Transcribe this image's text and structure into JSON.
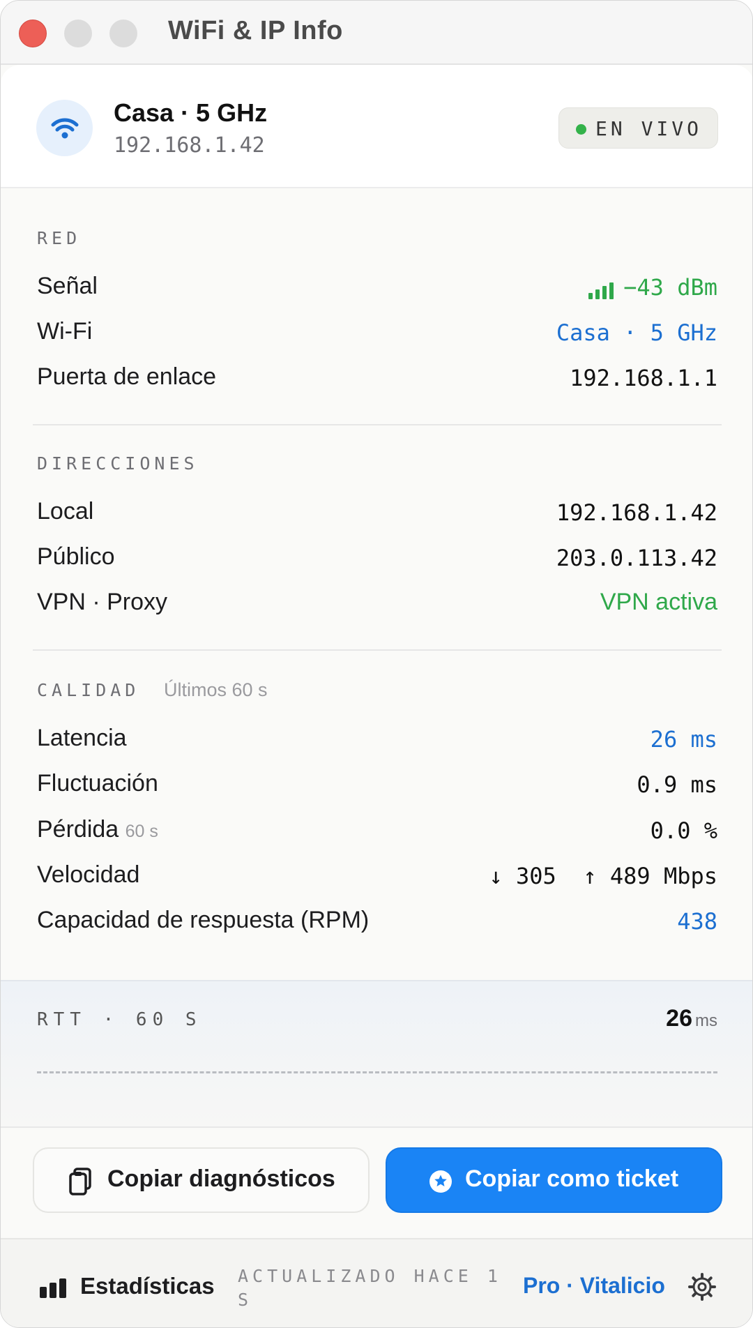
{
  "window": {
    "title": "WiFi & IP Info"
  },
  "header": {
    "network_name": "Casa · 5 GHz",
    "ip": "192.168.1.42",
    "live_label": "EN VIVO",
    "live_color": "#33b24a"
  },
  "red": {
    "label": "RED",
    "signal_label": "Señal",
    "signal_value": "−43 dBm",
    "signal_bars": 4,
    "wifi_label": "Wi-Fi",
    "wifi_value": "Casa · 5 GHz",
    "gateway_label": "Puerta de enlace",
    "gateway_value": "192.168.1.1"
  },
  "direcciones": {
    "label": "DIRECCIONES",
    "local_label": "Local",
    "local_value": "192.168.1.42",
    "public_label": "Público",
    "public_value": "203.0.113.42",
    "vpn_label": "VPN · Proxy",
    "vpn_value": "VPN activa"
  },
  "calidad": {
    "label": "CALIDAD",
    "window_note": "Últimos 60 s",
    "latency_label": "Latencia",
    "latency_value": "26 ms",
    "jitter_label": "Fluctuación",
    "jitter_value": "0.9 ms",
    "loss_label": "Pérdida",
    "loss_note": "60 s",
    "loss_value": "0.0 %",
    "speed_label": "Velocidad",
    "speed_value": "↓ 305  ↑ 489 Mbps",
    "rpm_label": "Capacidad de respuesta (RPM)",
    "rpm_value": "438"
  },
  "rtt": {
    "label": "RTT · 60 S",
    "value": "26",
    "unit": "ms"
  },
  "actions": {
    "copy_diagnostics": "Copiar diagnósticos",
    "copy_ticket": "Copiar como ticket",
    "primary_color": "#1a84f5"
  },
  "footer": {
    "stats_label": "Estadísticas",
    "updated": "ACTUALIZADO HACE 1 S",
    "pro_label": "Pro · Vitalicio"
  },
  "colors": {
    "green": "#2fa84a",
    "blue": "#1c6fd1"
  }
}
